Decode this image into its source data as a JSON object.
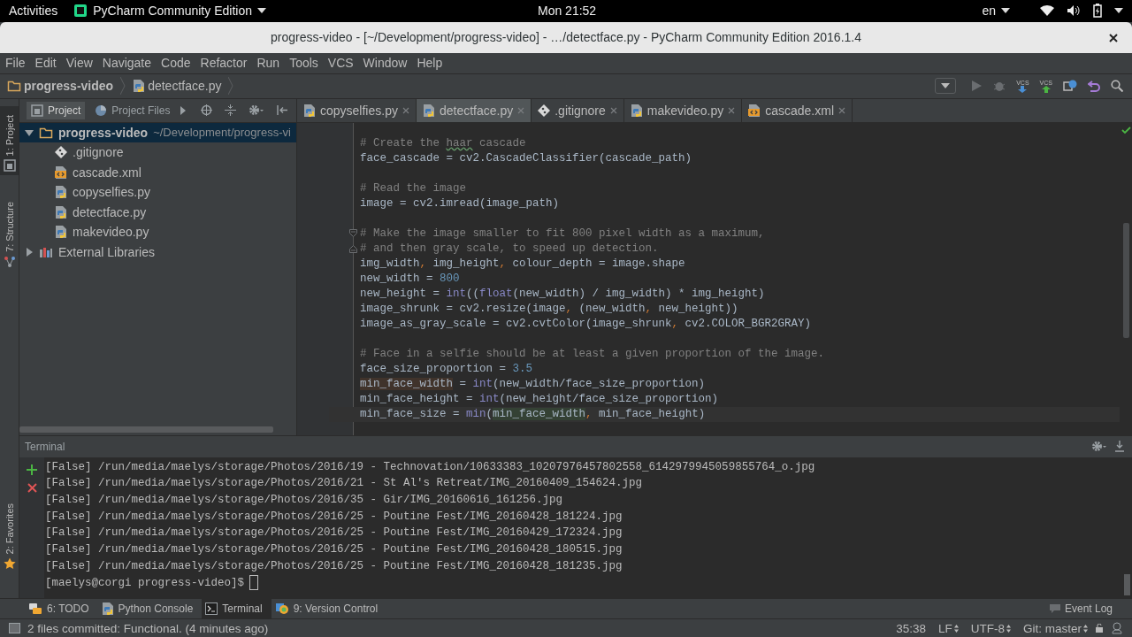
{
  "system_bar": {
    "activities": "Activities",
    "app_menu": "PyCharm Community Edition",
    "clock": "Mon 21:52",
    "language": "en"
  },
  "window": {
    "title": "progress-video - [~/Development/progress-video] - …/detectface.py - PyCharm Community Edition 2016.1.4"
  },
  "menu": [
    "File",
    "Edit",
    "View",
    "Navigate",
    "Code",
    "Refactor",
    "Run",
    "Tools",
    "VCS",
    "Window",
    "Help"
  ],
  "breadcrumbs": [
    {
      "label": "progress-video",
      "kind": "folder"
    },
    {
      "label": "detectface.py",
      "kind": "python"
    }
  ],
  "toolbar": [
    {
      "kind": "config"
    },
    {
      "kind": "run"
    },
    {
      "kind": "debug"
    },
    {
      "kind": "vcs-update",
      "label": "VCS"
    },
    {
      "kind": "vcs-commit",
      "label": "VCS"
    },
    {
      "kind": "history"
    },
    {
      "kind": "revert"
    },
    {
      "kind": "search"
    }
  ],
  "left_stripe": [
    {
      "label": "1: Project",
      "kind": "project",
      "selected": true
    },
    {
      "label": "7: Structure",
      "kind": "structure",
      "selected": false
    },
    {
      "label": "2: Favorites",
      "kind": "star",
      "selected": false
    }
  ],
  "project_panel": {
    "tabs": [
      {
        "label": "Project",
        "kind": "project",
        "selected": true
      },
      {
        "label": "Project Files",
        "kind": "pie",
        "selected": false
      }
    ],
    "tree": [
      {
        "label": "progress-video",
        "path": "~/Development/progress-vi",
        "kind": "folder",
        "expanded": true,
        "selected": true,
        "children": [
          {
            "label": ".gitignore",
            "kind": "git",
            "selected": false
          },
          {
            "label": "cascade.xml",
            "kind": "xml",
            "selected": false
          },
          {
            "label": "copyselfies.py",
            "kind": "python",
            "selected": false
          },
          {
            "label": "detectface.py",
            "kind": "python",
            "selected": false
          },
          {
            "label": "makevideo.py",
            "kind": "python",
            "selected": false
          }
        ]
      },
      {
        "label": "External Libraries",
        "kind": "library",
        "expanded": false,
        "selected": false
      }
    ]
  },
  "editor_tabs": [
    {
      "label": "copyselfies.py",
      "kind": "python",
      "selected": false
    },
    {
      "label": "detectface.py",
      "kind": "python",
      "selected": true
    },
    {
      "label": ".gitignore",
      "kind": "git",
      "selected": false
    },
    {
      "label": "makevideo.py",
      "kind": "python",
      "selected": false
    },
    {
      "label": "cascade.xml",
      "kind": "xml",
      "selected": false
    }
  ],
  "code": {
    "lines": [
      {
        "kind": "code",
        "current": false,
        "tokens": [
          {
            "text": "# Create the ",
            "kind": "comment"
          },
          {
            "text": "haar",
            "kind": "typo"
          },
          {
            "text": " cascade",
            "kind": "comment"
          }
        ]
      },
      {
        "kind": "code",
        "current": false,
        "tokens": [
          {
            "text": "face_cascade = cv2.CascadeClassifier(cascade_path)",
            "kind": "text"
          }
        ]
      },
      {
        "kind": "blank",
        "current": false
      },
      {
        "kind": "code",
        "current": false,
        "tokens": [
          {
            "text": "# Read the image",
            "kind": "comment"
          }
        ]
      },
      {
        "kind": "code",
        "current": false,
        "tokens": [
          {
            "text": "image = cv2.imread(image_path)",
            "kind": "text"
          }
        ]
      },
      {
        "kind": "blank",
        "current": false
      },
      {
        "kind": "fold-start",
        "current": false,
        "tokens": [
          {
            "text": "# Make the image smaller to fit 800 pixel width as a maximum,",
            "kind": "comment"
          }
        ]
      },
      {
        "kind": "fold-end",
        "current": false,
        "tokens": [
          {
            "text": "# and then gray scale, to speed up detection.",
            "kind": "comment"
          }
        ]
      },
      {
        "kind": "code",
        "current": false,
        "tokens": [
          {
            "text": "img_width",
            "kind": "text"
          },
          {
            "text": ",",
            "kind": "comma"
          },
          {
            "text": " img_height",
            "kind": "text"
          },
          {
            "text": ",",
            "kind": "comma"
          },
          {
            "text": " colour_depth = image.shape",
            "kind": "text"
          }
        ]
      },
      {
        "kind": "code",
        "current": false,
        "tokens": [
          {
            "text": "new_width = ",
            "kind": "text"
          },
          {
            "text": "800",
            "kind": "number"
          }
        ]
      },
      {
        "kind": "code",
        "current": false,
        "tokens": [
          {
            "text": "new_height = ",
            "kind": "text"
          },
          {
            "text": "int",
            "kind": "builtin"
          },
          {
            "text": "((",
            "kind": "text"
          },
          {
            "text": "float",
            "kind": "builtin"
          },
          {
            "text": "(new_width) / img_width) * img_height)",
            "kind": "text"
          }
        ]
      },
      {
        "kind": "code",
        "current": false,
        "tokens": [
          {
            "text": "image_shrunk = cv2.resize(image",
            "kind": "text"
          },
          {
            "text": ",",
            "kind": "comma"
          },
          {
            "text": " (new_width",
            "kind": "text"
          },
          {
            "text": ",",
            "kind": "comma"
          },
          {
            "text": " new_height))",
            "kind": "text"
          }
        ]
      },
      {
        "kind": "code",
        "current": false,
        "tokens": [
          {
            "text": "image_as_gray_scale = cv2.cvtColor(image_shrunk",
            "kind": "text"
          },
          {
            "text": ",",
            "kind": "comma"
          },
          {
            "text": " cv2.COLOR_BGR2GRAY)",
            "kind": "text"
          }
        ]
      },
      {
        "kind": "blank",
        "current": false
      },
      {
        "kind": "code",
        "current": false,
        "tokens": [
          {
            "text": "# Face in a selfie should be at least a given proportion of the image.",
            "kind": "comment"
          }
        ]
      },
      {
        "kind": "code",
        "current": false,
        "tokens": [
          {
            "text": "face_size_proportion = ",
            "kind": "text"
          },
          {
            "text": "3.5",
            "kind": "number"
          }
        ]
      },
      {
        "kind": "code",
        "current": false,
        "tokens": [
          {
            "text": "min_face_width",
            "kind": "write-usage"
          },
          {
            "text": " = ",
            "kind": "text"
          },
          {
            "text": "int",
            "kind": "builtin"
          },
          {
            "text": "(new_width/face_size_proportion)",
            "kind": "text"
          }
        ]
      },
      {
        "kind": "code",
        "current": false,
        "tokens": [
          {
            "text": "min_face_height = ",
            "kind": "text"
          },
          {
            "text": "int",
            "kind": "builtin"
          },
          {
            "text": "(new_height/face_size_proportion)",
            "kind": "text"
          }
        ]
      },
      {
        "kind": "code",
        "current": true,
        "tokens": [
          {
            "text": "min_face_size = ",
            "kind": "text"
          },
          {
            "text": "min",
            "kind": "builtin"
          },
          {
            "text": "(",
            "kind": "text"
          },
          {
            "text": "min_face_width",
            "kind": "read-usage"
          },
          {
            "text": ",",
            "kind": "comma"
          },
          {
            "text": " min_face_height)",
            "kind": "text"
          }
        ]
      }
    ]
  },
  "terminal": {
    "title": "Terminal",
    "lines": [
      "[False] /run/media/maelys/storage/Photos/2016/19 - Technovation/10633383_10207976457802558_6142979945059855764_o.jpg",
      "[False] /run/media/maelys/storage/Photos/2016/21 - St Al's Retreat/IMG_20160409_154624.jpg",
      "[False] /run/media/maelys/storage/Photos/2016/35 - Gir/IMG_20160616_161256.jpg",
      "[False] /run/media/maelys/storage/Photos/2016/25 - Poutine Fest/IMG_20160428_181224.jpg",
      "[False] /run/media/maelys/storage/Photos/2016/25 - Poutine Fest/IMG_20160429_172324.jpg",
      "[False] /run/media/maelys/storage/Photos/2016/25 - Poutine Fest/IMG_20160428_180515.jpg",
      "[False] /run/media/maelys/storage/Photos/2016/25 - Poutine Fest/IMG_20160428_181235.jpg"
    ],
    "prompt": "[maelys@corgi progress-video]$"
  },
  "tool_windows": [
    {
      "label": "6: TODO",
      "kind": "todo",
      "selected": false
    },
    {
      "label": "Python Console",
      "kind": "python",
      "selected": false
    },
    {
      "label": "Terminal",
      "kind": "terminal",
      "selected": true
    },
    {
      "label": "9: Version Control",
      "kind": "vcs",
      "selected": false
    }
  ],
  "event_log": "Event Log",
  "status_bar": {
    "message": "2 files committed: Functional. (4 minutes ago)",
    "position": "35:38",
    "line_separator": "LF",
    "encoding": "UTF-8",
    "vcs_branch": "Git: master"
  }
}
